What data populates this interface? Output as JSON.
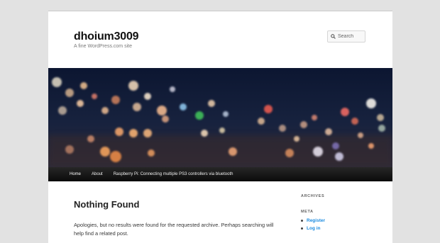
{
  "site": {
    "title": "dhoium3009",
    "description": "A fine WordPress.com site"
  },
  "search": {
    "placeholder": "Search"
  },
  "nav": {
    "items": [
      {
        "label": "Home"
      },
      {
        "label": "About"
      },
      {
        "label": "Raspberry Pi: Connecting multiple PS3 controllers via bluetooth"
      }
    ]
  },
  "main": {
    "title": "Nothing Found",
    "text": "Apologies, but no results were found for the requested archive. Perhaps searching will help find a related post."
  },
  "sidebar": {
    "archives_title": "ARCHIVES",
    "meta_title": "META",
    "meta_links": [
      {
        "label": "Register"
      },
      {
        "label": "Log in"
      }
    ]
  },
  "colors": {
    "link": "#1b8be0",
    "nav_background": "#1a1a1a",
    "page_background": "#e2e2e2"
  }
}
